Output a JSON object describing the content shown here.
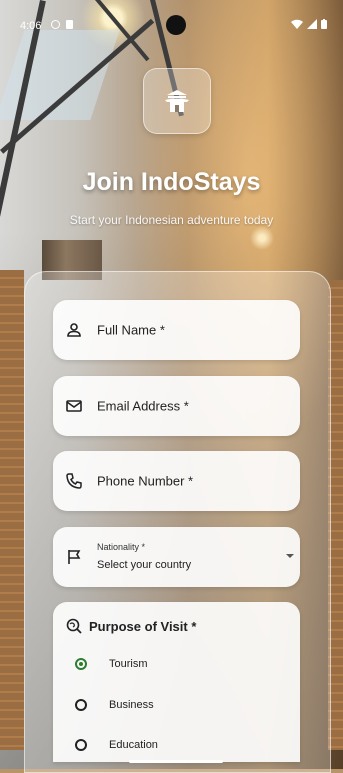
{
  "status_bar": {
    "time": "4:06"
  },
  "header": {
    "title": "Join IndoStays",
    "subtitle": "Start your Indonesian adventure today"
  },
  "form": {
    "full_name": {
      "label": "Full Name *",
      "icon": "person-icon"
    },
    "email": {
      "label": "Email Address *",
      "icon": "mail-icon"
    },
    "phone": {
      "label": "Phone Number *",
      "icon": "phone-icon"
    },
    "nationality": {
      "label": "Nationality *",
      "value": "Select your country",
      "icon": "flag-icon"
    },
    "purpose": {
      "label": "Purpose of Visit *",
      "icon": "travel-explore-icon",
      "options": [
        {
          "label": "Tourism",
          "selected": true
        },
        {
          "label": "Business",
          "selected": false
        },
        {
          "label": "Education",
          "selected": false
        }
      ]
    }
  },
  "colors": {
    "accent": "#2e7d32",
    "title": "#ffffff"
  }
}
